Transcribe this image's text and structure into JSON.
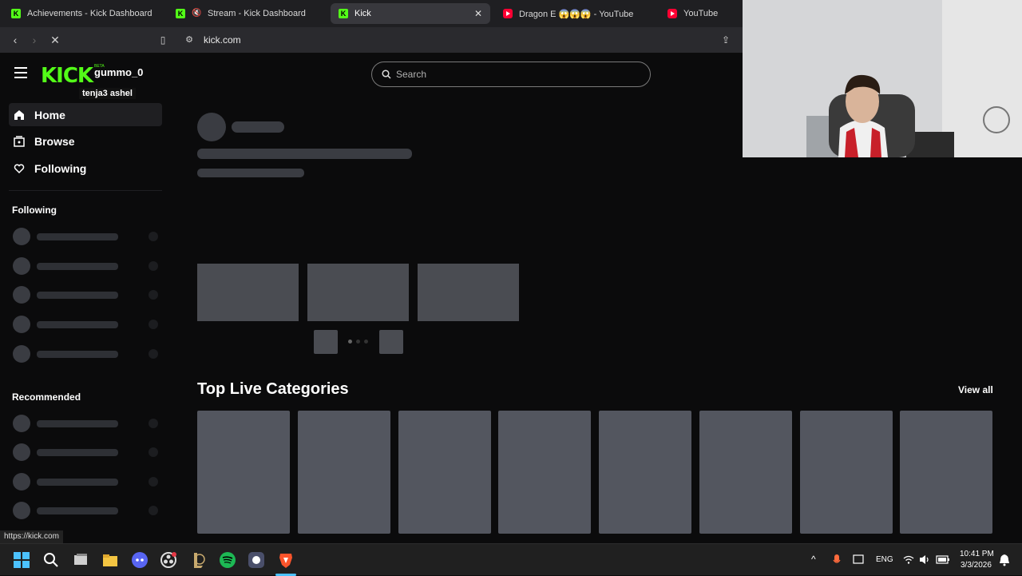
{
  "tabs": [
    {
      "label": "Achievements - Kick Dashboard",
      "icon": "kick-icon"
    },
    {
      "label": "Stream - Kick Dashboard",
      "icon": "kick-icon"
    },
    {
      "label": "Kick",
      "icon": "kick-icon",
      "active": true
    },
    {
      "label": "Dragon E 😱😱😱 - YouTube",
      "icon": "youtube-icon"
    },
    {
      "label": "YouTube",
      "icon": "youtube-icon"
    }
  ],
  "address": {
    "url": "kick.com"
  },
  "header": {
    "logo": "KICK",
    "logo_badge": "BETA",
    "overlay_name": "gummo_0",
    "overlay_sub": "tenja3 ashel",
    "search_placeholder": "Search"
  },
  "sidebar": {
    "items": [
      {
        "label": "Home",
        "icon": "home-icon"
      },
      {
        "label": "Browse",
        "icon": "browse-icon"
      },
      {
        "label": "Following",
        "icon": "heart-icon"
      }
    ],
    "following_heading": "Following",
    "recommended_heading": "Recommended"
  },
  "main": {
    "top_live_title": "Top Live Categories",
    "view_all": "View all"
  },
  "status_url": "https://kick.com",
  "taskbar": {
    "lang": "ENG",
    "time": "10:41 PM",
    "date": "3/3/2026"
  },
  "colors": {
    "brand": "#53fc18",
    "skeleton": "#3a3c42"
  }
}
